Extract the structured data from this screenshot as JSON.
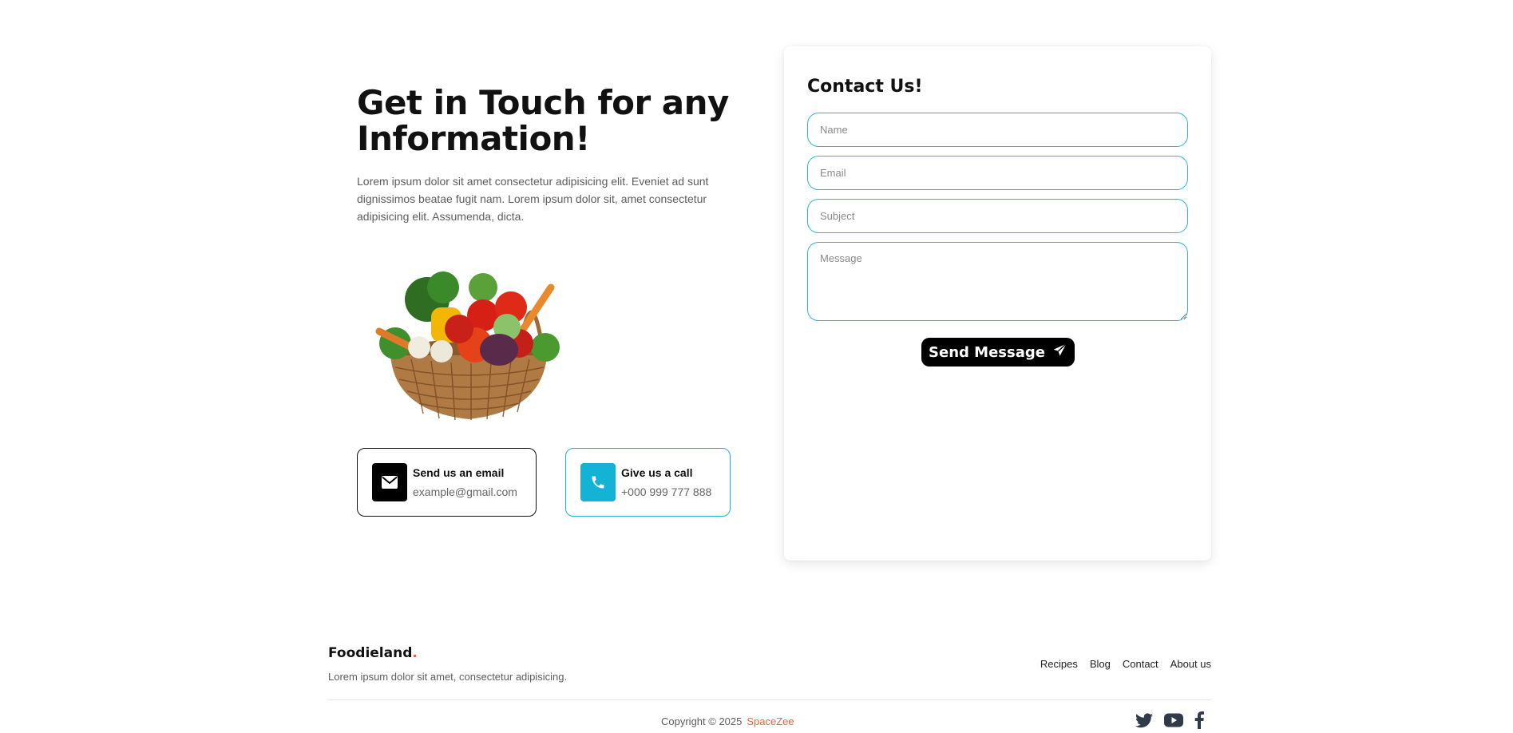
{
  "hero": {
    "title": "Get in Touch for any Information!",
    "text": "Lorem ipsum dolor sit amet consectetur adipisicing elit. Eveniet ad sunt dignissimos beatae fugit nam. Lorem ipsum dolor sit, amet consectetur adipisicing elit. Assumenda, dicta."
  },
  "info_cards": [
    {
      "title": "Send us an email",
      "value": "example@gmail.com",
      "icon": "envelope-icon"
    },
    {
      "title": "Give us a call",
      "value": "+000 999 777 888",
      "icon": "phone-icon"
    }
  ],
  "contact_form": {
    "title": "Contact Us!",
    "name_placeholder": "Name",
    "email_placeholder": "Email",
    "subject_placeholder": "Subject",
    "message_placeholder": "Message",
    "send_label": "Send Message",
    "send_icon": "paper-plane-icon"
  },
  "footer": {
    "brand": "Foodieland",
    "brand_dot": ".",
    "tagline": "Lorem ipsum dolor sit amet, consectetur adipisicing.",
    "nav": [
      "Recipes",
      "Blog",
      "Contact",
      "About us"
    ],
    "copyright": "Copyright © 2025",
    "copyright_brand": "SpaceZee",
    "socials": [
      "twitter-icon",
      "youtube-icon",
      "facebook-icon"
    ]
  },
  "colors": {
    "accent": "#14b3d6",
    "brand": "#e8633a",
    "text": "#111111",
    "muted": "#5d5d5d"
  }
}
